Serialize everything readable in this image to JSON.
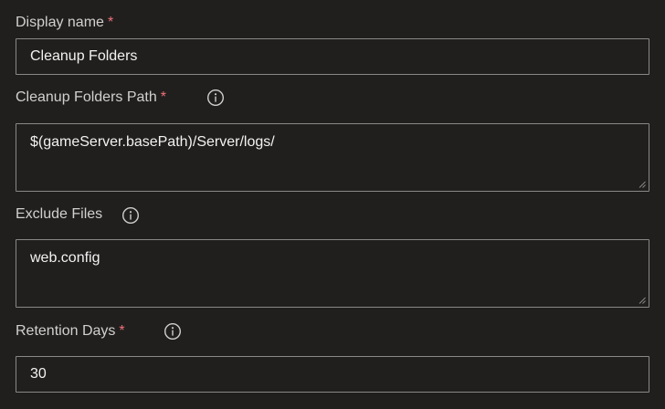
{
  "fields": {
    "display_name": {
      "label": "Display name",
      "required_marker": "*",
      "value": "Cleanup Folders"
    },
    "cleanup_path": {
      "label": "Cleanup Folders Path",
      "required_marker": "*",
      "value": "$(gameServer.basePath)/Server/logs/"
    },
    "exclude_files": {
      "label": "Exclude Files",
      "value": "web.config"
    },
    "retention_days": {
      "label": "Retention Days",
      "required_marker": "*",
      "value": "30"
    }
  },
  "icons": {
    "info": "info-icon",
    "resize": "resize-grip-icon"
  },
  "colors": {
    "background": "#201f1e",
    "label_text": "#d2d0ce",
    "input_text": "#f3f2f1",
    "required_marker": "#f1707b",
    "input_border": "#8a8886"
  }
}
